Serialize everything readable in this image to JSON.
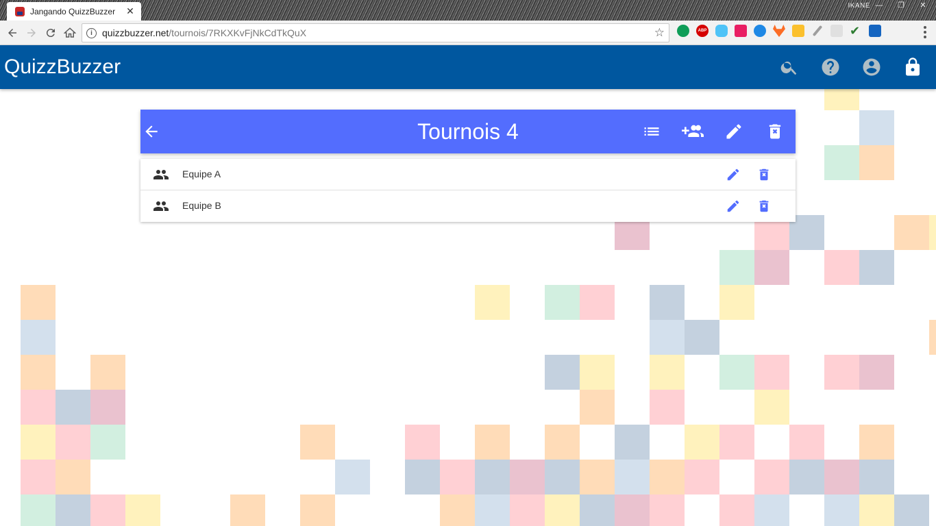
{
  "browser": {
    "tab_title": "Jangando QuizzBuzzer",
    "tab_close": "✕",
    "url_host": "quizzbuzzer.net",
    "url_path": "/tournois/7RKXKvFjNkCdTkQuX",
    "profile_name": "IKANE",
    "window_controls": [
      "—",
      "❐",
      "✕"
    ],
    "icons": [
      "back-icon",
      "forward-icon",
      "reload-icon",
      "home-icon",
      "info-icon",
      "star-icon",
      "menu-icon"
    ]
  },
  "app": {
    "brand": "QuizzBuzzer",
    "appbar_icons": [
      "search-icon",
      "help-icon",
      "account-icon",
      "lock-icon"
    ]
  },
  "tournament": {
    "title": "Tournois 4",
    "header_icons": [
      "back-arrow-icon",
      "list-icon",
      "add-group-icon",
      "edit-icon",
      "delete-icon"
    ],
    "teams": [
      {
        "name": "Equipe A"
      },
      {
        "name": "Equipe B"
      }
    ]
  },
  "colors": {
    "appbar": "#00579f",
    "card_header": "#536dfe",
    "action_icon": "#536dfe",
    "team_icon": "#333333"
  }
}
